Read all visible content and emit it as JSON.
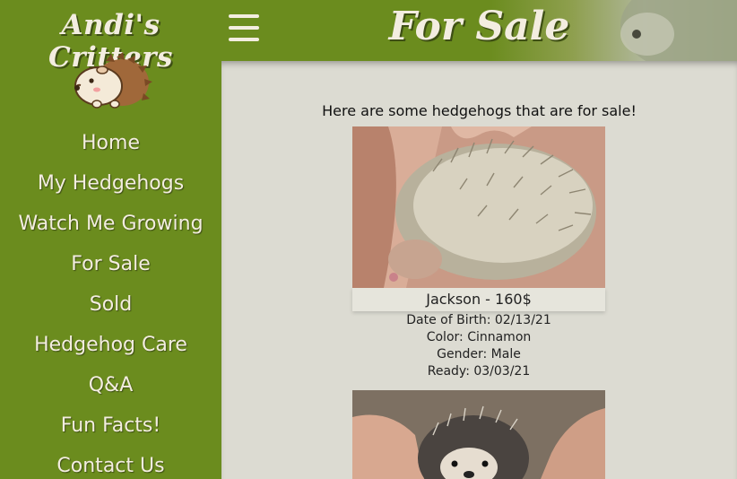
{
  "sidebar": {
    "brand": "Andi's Critters",
    "logo_icon": "hedgehog-logo-icon",
    "nav": [
      {
        "label": "Home"
      },
      {
        "label": "My Hedgehogs"
      },
      {
        "label": "Watch Me Growing"
      },
      {
        "label": "For Sale"
      },
      {
        "label": "Sold"
      },
      {
        "label": "Hedgehog Care"
      },
      {
        "label": "Q&A"
      },
      {
        "label": "Fun Facts!"
      },
      {
        "label": "Contact Us"
      }
    ]
  },
  "header": {
    "title": "For Sale",
    "menu_icon": "hamburger-menu-icon"
  },
  "main": {
    "intro": "Here are some hedgehogs that are for sale!",
    "listings": [
      {
        "name_price": "Jackson - 160$",
        "dob": "Date of Birth: 02/13/21",
        "color": "Color: Cinnamon",
        "gender": "Gender: Male",
        "ready": "Ready: 03/03/21"
      }
    ]
  },
  "colors": {
    "sidebar_green": "#6b8c1e",
    "content_bg": "#dcdbd2",
    "text_cream": "#f3ede0"
  }
}
